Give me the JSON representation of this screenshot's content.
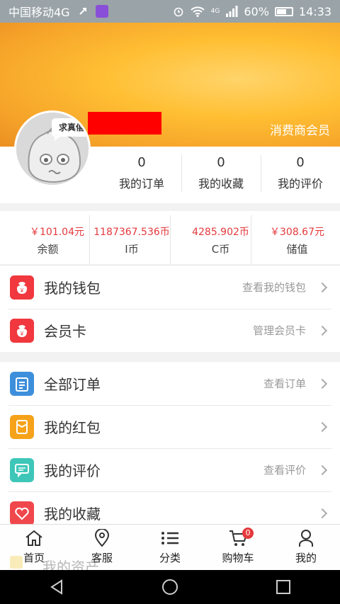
{
  "status_bar": {
    "carrier": "中国移动4G",
    "net_small": "4G",
    "battery": "60%",
    "time": "14:33"
  },
  "header": {
    "member_level": "消费商会员",
    "avatar_text": "求真僖"
  },
  "stats": [
    {
      "value": "0",
      "label": "我的订单"
    },
    {
      "value": "0",
      "label": "我的收藏"
    },
    {
      "value": "0",
      "label": "我的评价"
    }
  ],
  "balances": [
    {
      "amount": "￥101.04元",
      "label": "余额"
    },
    {
      "amount": "1187367.536币",
      "label": "I币"
    },
    {
      "amount": "4285.902币",
      "label": "C币"
    },
    {
      "amount": "￥308.67元",
      "label": "储值"
    }
  ],
  "group1": [
    {
      "title": "我的钱包",
      "hint": "查看我的钱包",
      "icon": "wallet-icon",
      "color": "#f0383e"
    },
    {
      "title": "会员卡",
      "hint": "管理会员卡",
      "icon": "member-card-icon",
      "color": "#f0383e"
    }
  ],
  "group2": [
    {
      "title": "全部订单",
      "hint": "查看订单",
      "icon": "clipboard-icon",
      "color": "#3d8fdb"
    },
    {
      "title": "我的红包",
      "hint": "",
      "icon": "red-packet-icon",
      "color": "#f6a21a"
    },
    {
      "title": "我的评价",
      "hint": "查看评价",
      "icon": "comment-icon",
      "color": "#3ec7b8"
    },
    {
      "title": "我的收藏",
      "hint": "",
      "icon": "heart-icon",
      "color": "#f0474d"
    }
  ],
  "hidden_row": {
    "title": "我的资产"
  },
  "tabs": [
    {
      "label": "首页",
      "icon": "home-icon"
    },
    {
      "label": "客服",
      "icon": "location-icon"
    },
    {
      "label": "分类",
      "icon": "list-icon"
    },
    {
      "label": "购物车",
      "icon": "cart-icon",
      "badge": "0"
    },
    {
      "label": "我的",
      "icon": "user-icon"
    }
  ]
}
